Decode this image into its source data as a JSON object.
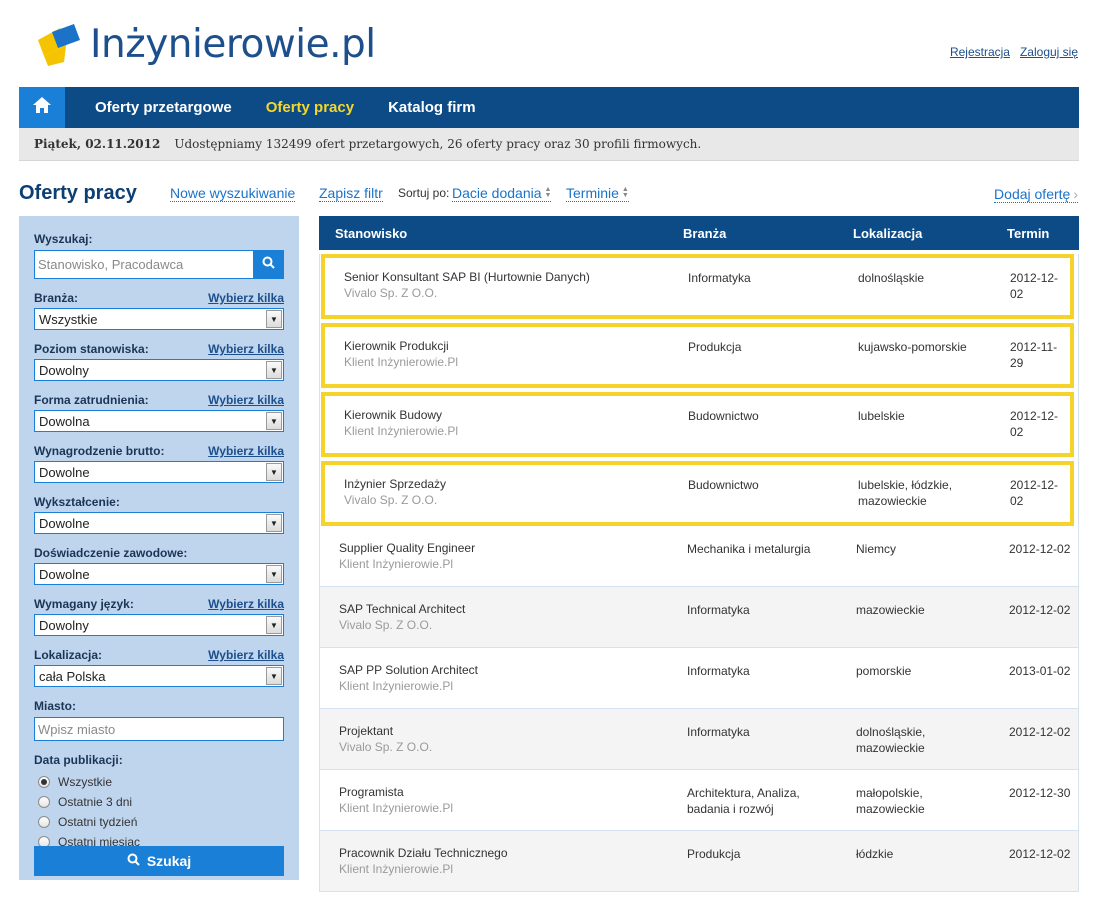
{
  "brand": {
    "name": "Inżynierowie.pl"
  },
  "top_links": {
    "register": "Rejestracja",
    "login": "Zaloguj się"
  },
  "nav": {
    "home_icon": "home-icon",
    "items": [
      {
        "label": "Oferty przetargowe",
        "active": false
      },
      {
        "label": "Oferty pracy",
        "active": true
      },
      {
        "label": "Katalog firm",
        "active": false
      }
    ]
  },
  "infobar": {
    "date": "Piątek, 02.11.2012",
    "message": "Udostępniamy 132499 ofert przetargowych, 26 oferty pracy oraz 30 profili firmowych."
  },
  "toolbar": {
    "title": "Oferty pracy",
    "new_search": "Nowe wyszukiwanie",
    "save_filter": "Zapisz filtr",
    "sort_label": "Sortuj po:",
    "sort_date": "Dacie dodania",
    "sort_deadline": "Terminie",
    "add_offer": "Dodaj ofertę"
  },
  "filters": {
    "search": {
      "label": "Wyszukaj:",
      "placeholder": "Stanowisko, Pracodawca"
    },
    "pick_label": "Wybierz kilka",
    "branza": {
      "label": "Branża:",
      "value": "Wszystkie"
    },
    "poziom": {
      "label": "Poziom stanowiska:",
      "value": "Dowolny"
    },
    "forma": {
      "label": "Forma zatrudnienia:",
      "value": "Dowolna"
    },
    "wynagrodzenie": {
      "label": "Wynagrodzenie brutto:",
      "value": "Dowolne"
    },
    "wyksztalcenie": {
      "label": "Wykształcenie:",
      "value": "Dowolne"
    },
    "doswiadczenie": {
      "label": "Doświadczenie zawodowe:",
      "value": "Dowolne"
    },
    "jezyk": {
      "label": "Wymagany język:",
      "value": "Dowolny"
    },
    "lokalizacja": {
      "label": "Lokalizacja:",
      "value": "cała Polska"
    },
    "miasto": {
      "label": "Miasto:",
      "placeholder": "Wpisz miasto"
    },
    "data_publikacji": {
      "label": "Data publikacji:",
      "options": [
        "Wszystkie",
        "Ostatnie 3 dni",
        "Ostatni tydzień",
        "Ostatni miesiąc"
      ],
      "selected": 0
    },
    "submit": "Szukaj"
  },
  "table": {
    "headers": {
      "position": "Stanowisko",
      "industry": "Branża",
      "location": "Lokalizacja",
      "deadline": "Termin"
    },
    "rows": [
      {
        "title": "Senior Konsultant SAP BI (Hurtownie Danych)",
        "company": "Vivalo Sp. Z O.O.",
        "industry": "Informatyka",
        "location": "dolnośląskie",
        "deadline": "2012-12-02",
        "featured": true
      },
      {
        "title": "Kierownik Produkcji",
        "company": "Klient Inżynierowie.Pl",
        "industry": "Produkcja",
        "location": "kujawsko-pomorskie",
        "deadline": "2012-11-29",
        "featured": true
      },
      {
        "title": "Kierownik Budowy",
        "company": "Klient Inżynierowie.Pl",
        "industry": "Budownictwo",
        "location": "lubelskie",
        "deadline": "2012-12-02",
        "featured": true
      },
      {
        "title": "Inżynier Sprzedaży",
        "company": "Vivalo Sp. Z O.O.",
        "industry": "Budownictwo",
        "location": "lubelskie, łódzkie, mazowieckie",
        "deadline": "2012-12-02",
        "featured": true
      },
      {
        "title": "Supplier Quality Engineer",
        "company": "Klient Inżynierowie.Pl",
        "industry": "Mechanika i metalurgia",
        "location": "Niemcy",
        "deadline": "2012-12-02",
        "featured": false
      },
      {
        "title": "SAP Technical Architect",
        "company": "Vivalo Sp. Z O.O.",
        "industry": "Informatyka",
        "location": "mazowieckie",
        "deadline": "2012-12-02",
        "featured": false
      },
      {
        "title": "SAP PP Solution Architect",
        "company": "Klient Inżynierowie.Pl",
        "industry": "Informatyka",
        "location": "pomorskie",
        "deadline": "2013-01-02",
        "featured": false
      },
      {
        "title": "Projektant",
        "company": "Vivalo Sp. Z O.O.",
        "industry": "Informatyka",
        "location": "dolnośląskie, mazowieckie",
        "deadline": "2012-12-02",
        "featured": false
      },
      {
        "title": "Programista",
        "company": "Klient Inżynierowie.Pl",
        "industry": "Architektura, Analiza, badania i rozwój",
        "location": "małopolskie, mazowieckie",
        "deadline": "2012-12-30",
        "featured": false
      },
      {
        "title": "Pracownik Działu Technicznego",
        "company": "Klient Inżynierowie.Pl",
        "industry": "Produkcja",
        "location": "łódzkie",
        "deadline": "2012-12-02",
        "featured": false
      }
    ]
  },
  "colors": {
    "nav": "#0d4b86",
    "accent": "#1a7fd6",
    "highlight": "#f5d32a",
    "active_nav": "#f5d62a"
  }
}
